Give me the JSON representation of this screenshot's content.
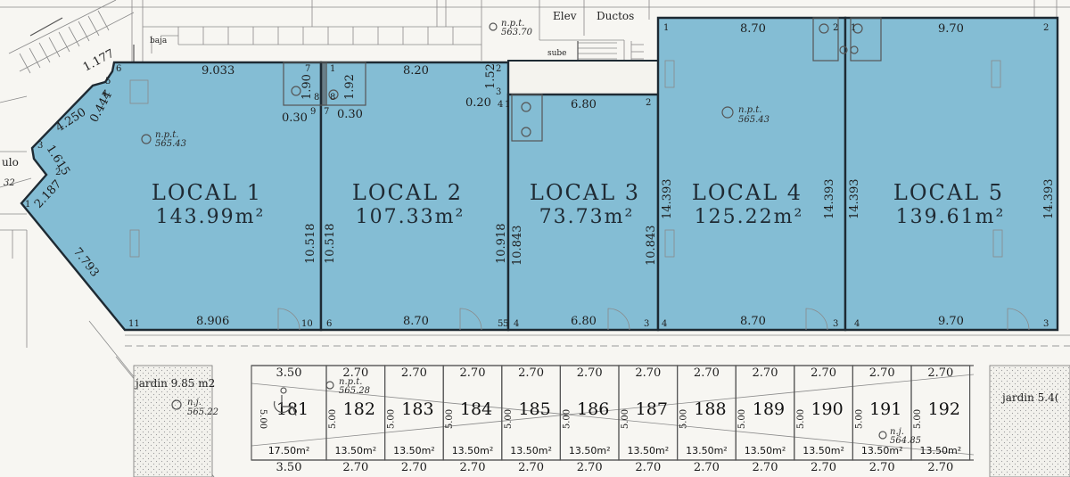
{
  "labels": {
    "elev": "Elev",
    "ductos": "Ductos",
    "baja": "baja",
    "sube": "sube",
    "jardin_left": "jardin 9.85 m2",
    "jardin_right": "jardin 5.4(",
    "edge_top": "1.177",
    "edge_left": "ulo",
    "edge_left_num": "32"
  },
  "levels": {
    "top": {
      "tag": "n.p.t.",
      "value": "563.70"
    },
    "local1": {
      "tag": "n.p.t.",
      "value": "565.43"
    },
    "local4": {
      "tag": "n.p.t.",
      "value": "565.43"
    },
    "parking": {
      "tag": "n.p.t.",
      "value": "565.28"
    },
    "garden": {
      "tag": "n.j.",
      "value": "565.22"
    },
    "p191": {
      "tag": "n.j.",
      "value": "564.85"
    }
  },
  "locales": [
    {
      "name": "LOCAL 1",
      "area": "143.99m²"
    },
    {
      "name": "LOCAL 2",
      "area": "107.33m²"
    },
    {
      "name": "LOCAL 3",
      "area": "73.73m²"
    },
    {
      "name": "LOCAL 4",
      "area": "125.22m²"
    },
    {
      "name": "LOCAL 5",
      "area": "139.61m²"
    }
  ],
  "dimensions": {
    "l1_top": "9.033",
    "l1_bottom": "8.906",
    "l1_right": "10.518",
    "l1_diag_a": "4.250",
    "l1_diag_b": "0.444",
    "l1_diag_c": "1.615",
    "l1_diag_d": "2.187",
    "l1_diag_e": "7.793",
    "l1_bath_a": "1.90",
    "l1_bath_b": "0.30",
    "l2_top": "8.20",
    "l2_bottom": "8.70",
    "l2_left": "10.518",
    "l2_right": "10.918",
    "l2_bath_a": "1.92",
    "l2_bath_b": "0.30",
    "l2_step_v": "1.52",
    "l2_step_h": "0.20",
    "l3_top": "6.80",
    "l3_bottom": "6.80",
    "l3_left": "10.843",
    "l3_right": "10.843",
    "l4_top": "8.70",
    "l4_bottom": "8.70",
    "l4_left": "14.393",
    "l4_right": "14.393",
    "l5_top": "9.70",
    "l5_bottom": "9.70",
    "l5_left": "14.393",
    "l5_right": "14.393"
  },
  "vertices": {
    "l1": [
      "6",
      "5",
      "4",
      "3",
      "2",
      "1",
      "11",
      "10",
      "9",
      "8",
      "7"
    ],
    "l2": [
      "8",
      "7",
      "6",
      "5",
      "4",
      "3",
      "2",
      "1"
    ],
    "l3": [
      "1",
      "2",
      "3",
      "4",
      "5"
    ],
    "l4": [
      "1",
      "2",
      "3",
      "4"
    ],
    "l5": [
      "1",
      "2",
      "3",
      "4"
    ]
  },
  "parking": {
    "depth": "5.00",
    "spaces": [
      {
        "number": "181",
        "width": "3.50",
        "area": "17.50m²"
      },
      {
        "number": "182",
        "width": "2.70",
        "area": "13.50m²"
      },
      {
        "number": "183",
        "width": "2.70",
        "area": "13.50m²"
      },
      {
        "number": "184",
        "width": "2.70",
        "area": "13.50m²"
      },
      {
        "number": "185",
        "width": "2.70",
        "area": "13.50m²"
      },
      {
        "number": "186",
        "width": "2.70",
        "area": "13.50m²"
      },
      {
        "number": "187",
        "width": "2.70",
        "area": "13.50m²"
      },
      {
        "number": "188",
        "width": "2.70",
        "area": "13.50m²"
      },
      {
        "number": "189",
        "width": "2.70",
        "area": "13.50m²"
      },
      {
        "number": "190",
        "width": "2.70",
        "area": "13.50m²"
      },
      {
        "number": "191",
        "width": "2.70",
        "area": "13.50m²"
      },
      {
        "number": "192",
        "width": "2.70",
        "area": "13.50m²"
      }
    ]
  }
}
